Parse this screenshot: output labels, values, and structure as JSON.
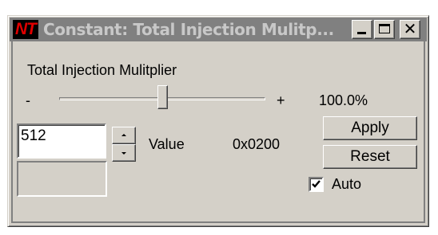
{
  "window": {
    "logo_text": "NT",
    "title": "Constant: Total Injection Mulitp...",
    "minimize_icon": "minimize-icon",
    "maximize_icon": "maximize-icon",
    "close_icon": "close-icon",
    "close_glyph": "✕"
  },
  "content": {
    "heading": "Total Injection Mulitplier",
    "slider": {
      "minus_label": "-",
      "plus_label": "+",
      "percent_text": "100.0%",
      "position_fraction": 0.5
    },
    "value_input": "512",
    "value_label": "Value",
    "hex_value": "0x0200",
    "apply_label": "Apply",
    "reset_label": "Reset",
    "auto_label": "Auto",
    "auto_checked": true
  }
}
